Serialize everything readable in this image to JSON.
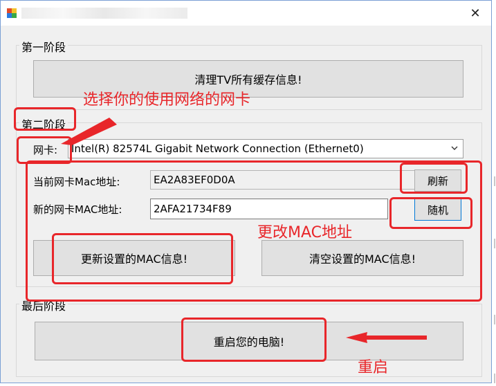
{
  "window": {
    "close_glyph": "✕"
  },
  "stage1": {
    "title": "第一阶段",
    "clear_cache_button": "清理TV所有缓存信息!"
  },
  "stage2": {
    "title": "第二阶段",
    "nic_label": "网卡:",
    "nic_selected": "Intel(R) 82574L Gigabit Network Connection (Ethernet0)",
    "current_mac_label": "当前网卡Mac地址:",
    "current_mac_value": "EA2A83EF0D0A",
    "refresh_button": "刷新",
    "new_mac_label": "新的网卡MAC地址:",
    "new_mac_value": "2AFA21734F89",
    "random_button": "随机",
    "update_button": "更新设置的MAC信息!",
    "clear_button": "清空设置的MAC信息!"
  },
  "stage3": {
    "title": "最后阶段",
    "restart_button": "重启您的电脑!"
  },
  "annotations": {
    "choose_nic": "选择你的使用网络的网卡",
    "change_mac": "更改MAC地址",
    "restart": "重启",
    "color": "#e8262a"
  },
  "icons": [
    "app-icon",
    "close-icon",
    "chevron-down-icon"
  ]
}
